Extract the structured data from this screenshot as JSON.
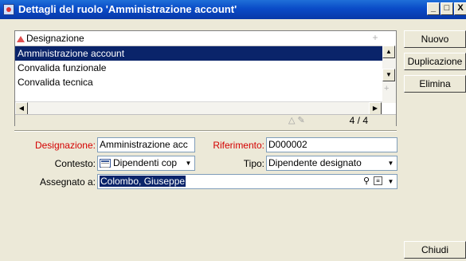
{
  "window": {
    "title": "Dettagli del ruolo 'Amministrazione account'",
    "minimize": "_",
    "maximize": "□",
    "close": "X"
  },
  "list": {
    "header": "Designazione",
    "rows": [
      "Amministrazione account",
      "Convalida funzionale",
      "Convalida tecnica"
    ],
    "count": "4 / 4"
  },
  "buttons": {
    "new": "Nuovo",
    "duplicate": "Duplicazione",
    "delete": "Elimina",
    "close": "Chiudi"
  },
  "form": {
    "designazione_label": "Designazione:",
    "designazione_value": "Amministrazione acc",
    "riferimento_label": "Riferimento:",
    "riferimento_value": "D000002",
    "contesto_label": "Contesto:",
    "contesto_value": "Dipendenti cop",
    "tipo_label": "Tipo:",
    "tipo_value": "Dipendente designato",
    "assegnato_label": "Assegnato a:",
    "assegnato_value": "Colombo, Giuseppe"
  },
  "colors": {
    "title_bar": "#0a4bc7",
    "selection": "#0a246a",
    "required_label": "#d40000"
  }
}
